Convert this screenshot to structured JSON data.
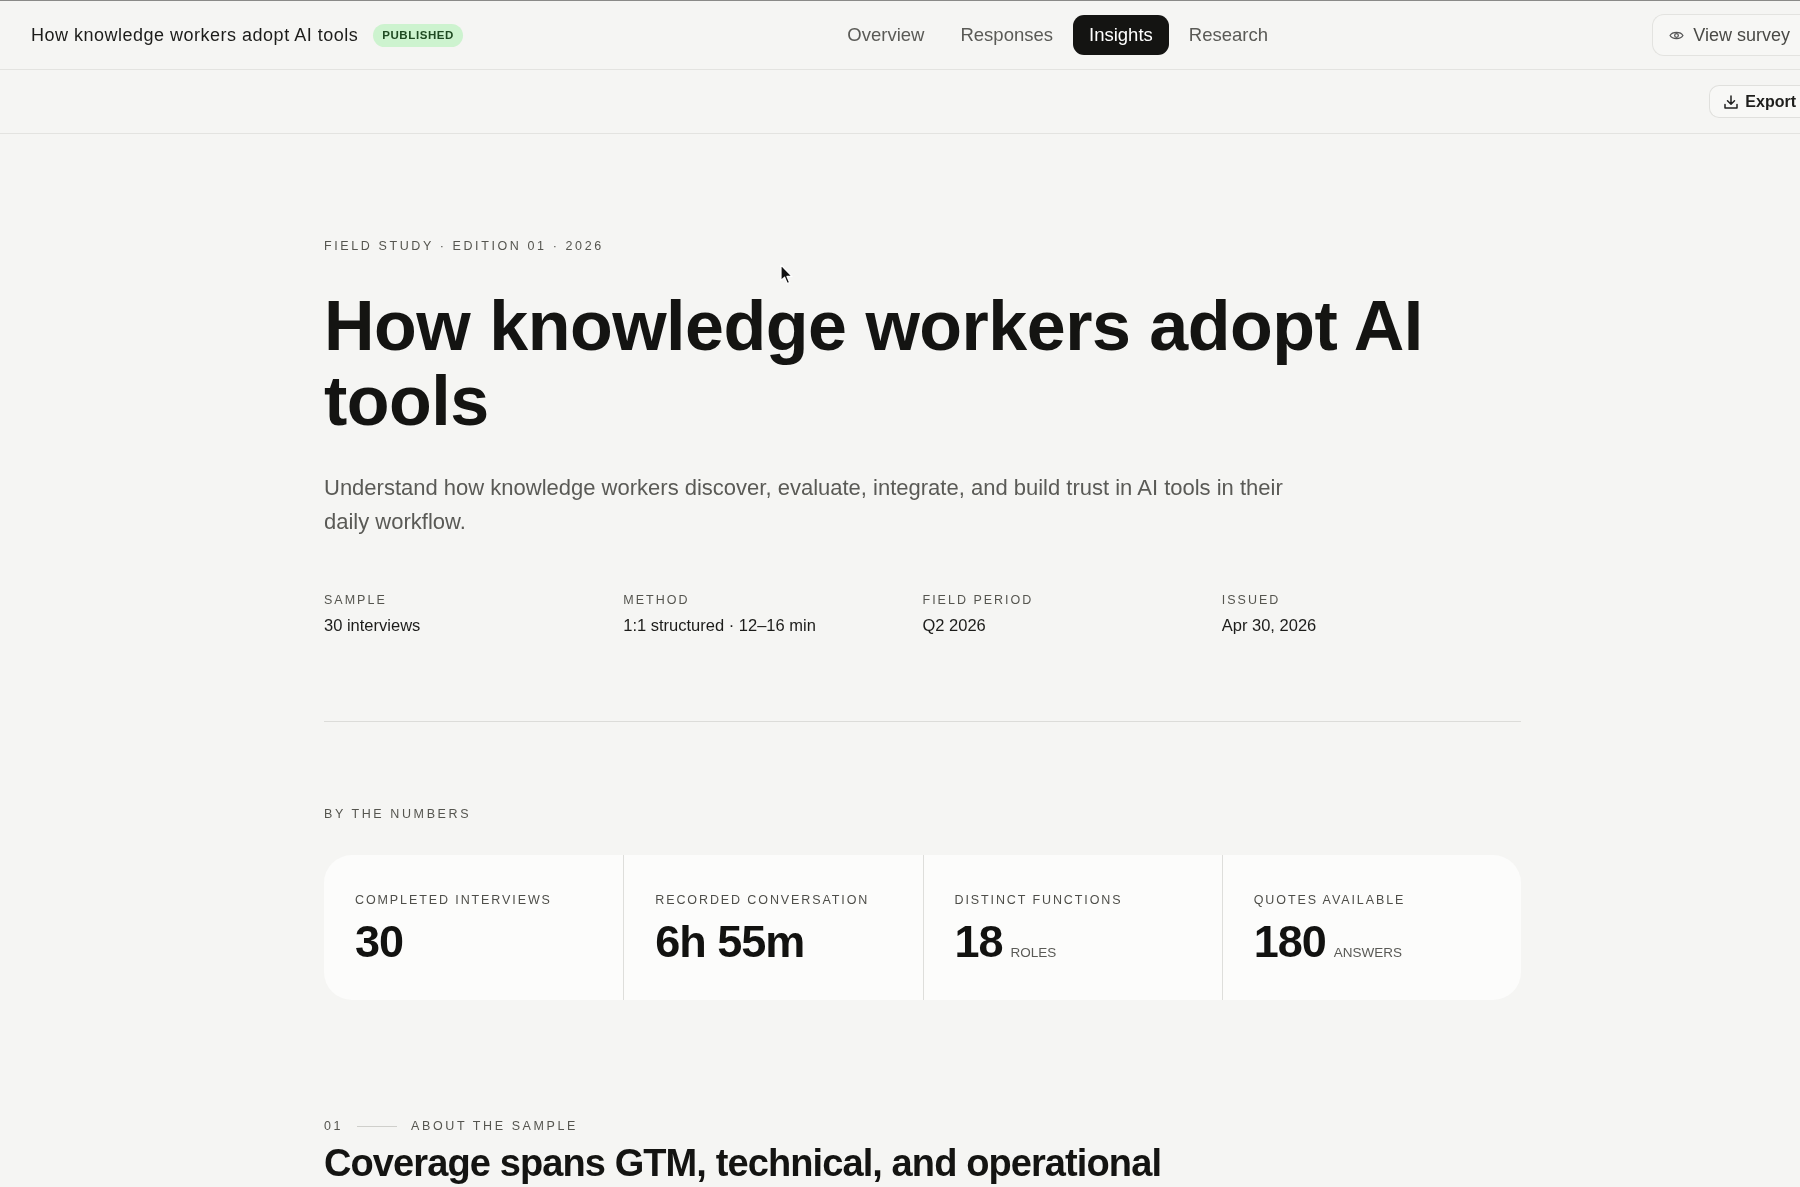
{
  "header": {
    "title": "How knowledge workers adopt AI tools",
    "badge": "PUBLISHED"
  },
  "tabs": [
    {
      "label": "Overview",
      "selected": false
    },
    {
      "label": "Responses",
      "selected": false
    },
    {
      "label": "Insights",
      "selected": true
    },
    {
      "label": "Research",
      "selected": false
    }
  ],
  "actions": {
    "view_survey": "View survey",
    "export": "Export"
  },
  "report": {
    "eyebrow": "FIELD STUDY · EDITION 01 · 2026",
    "title": "How knowledge workers adopt AI tools",
    "description": "Understand how knowledge workers discover, evaluate, integrate, and build trust in AI tools in their daily workflow.",
    "meta": [
      {
        "label": "SAMPLE",
        "value": "30 interviews"
      },
      {
        "label": "METHOD",
        "value": "1:1 structured · 12–16 min"
      },
      {
        "label": "FIELD PERIOD",
        "value": "Q2 2026"
      },
      {
        "label": "ISSUED",
        "value": "Apr 30, 2026"
      }
    ]
  },
  "numbers": {
    "heading": "BY THE NUMBERS",
    "stats": [
      {
        "label": "COMPLETED INTERVIEWS",
        "value": "30"
      },
      {
        "label": "RECORDED CONVERSATION",
        "value": "6h 55m"
      },
      {
        "label": "DISTINCT FUNCTIONS",
        "value": "18",
        "unit": "ROLES"
      },
      {
        "label": "QUOTES AVAILABLE",
        "value": "180",
        "unit": "ANSWERS"
      }
    ]
  },
  "section": {
    "number": "01",
    "label": "ABOUT THE SAMPLE",
    "heading": "Coverage spans GTM, technical, and operational"
  }
}
